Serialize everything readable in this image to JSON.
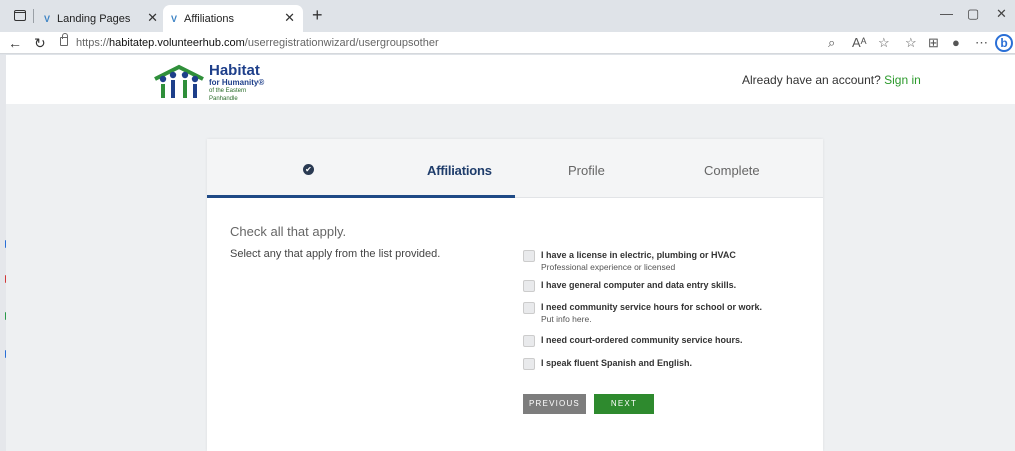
{
  "browser": {
    "tabs": [
      {
        "label": "Landing Pages"
      },
      {
        "label": "Affiliations",
        "active": true
      }
    ],
    "url_prefix": "https://",
    "url_domain": "habitatep.volunteerhub.com",
    "url_path": "/userregistrationwizard/usergroupsother",
    "icons": [
      "tab-actions-icon",
      "back-icon",
      "refresh-icon",
      "lock-icon",
      "zoom-icon",
      "read-aloud-icon",
      "favorite-icon",
      "favorites-icon",
      "collections-icon",
      "profile-icon",
      "more-icon",
      "bing-icon",
      "minimize-icon",
      "maximize-icon",
      "close-icon"
    ]
  },
  "header": {
    "logo": {
      "line1": "Habitat",
      "line2": "for Humanity®",
      "line3": "of the Eastern Panhandle"
    },
    "account_prompt": "Already have an account?",
    "sign_in": "Sign in"
  },
  "wizard": {
    "steps": {
      "affiliations": "Affiliations",
      "profile": "Profile",
      "complete": "Complete"
    },
    "heading": "Check all that apply.",
    "subheading": "Select any that apply from the list provided.",
    "options": [
      {
        "label": "I have a license in electric, plumbing or HVAC",
        "note": "Professional experience or licensed"
      },
      {
        "label": "I have general computer and data entry skills.",
        "note": ""
      },
      {
        "label": "I need community service hours for school or work.",
        "note": "Put info here."
      },
      {
        "label": "I need court-ordered community service hours.",
        "note": ""
      },
      {
        "label": "I speak fluent Spanish and English.",
        "note": ""
      }
    ],
    "previous_label": "PREVIOUS",
    "next_label": "NEXT"
  },
  "colors": {
    "accent_blue": "#1f4a86",
    "green": "#2e8a2e",
    "link_green": "#2c9a2c"
  }
}
